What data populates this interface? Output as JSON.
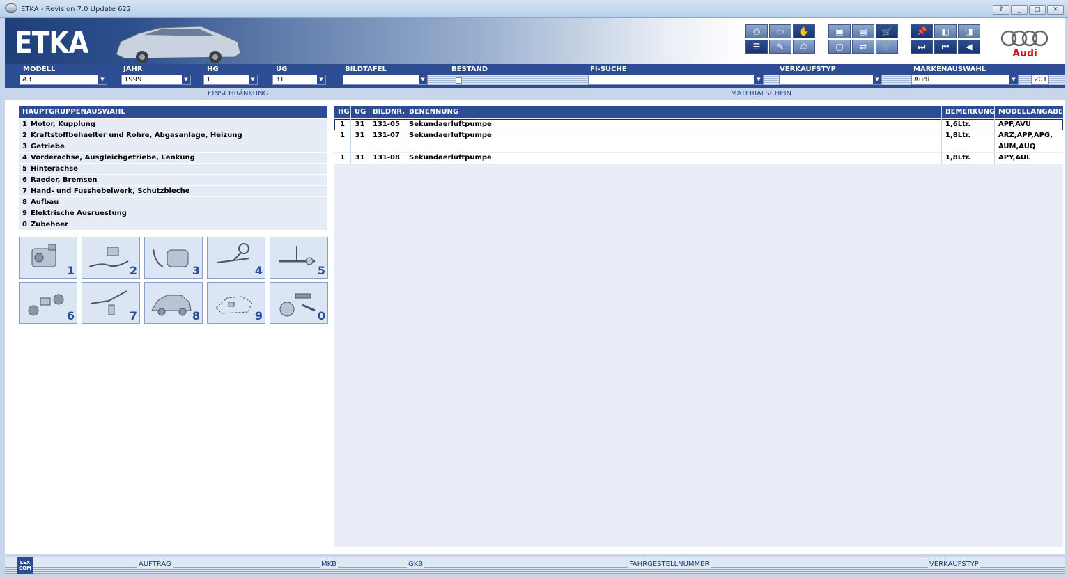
{
  "window": {
    "title": "ETKA - Revision 7.0 Update 622",
    "buttons": [
      "?",
      "_",
      "□",
      "✕"
    ]
  },
  "header": {
    "logo": "ETKA",
    "brand": "Audi"
  },
  "filters": {
    "modell": {
      "label": "MODELL",
      "value": "A3"
    },
    "jahr": {
      "label": "JAHR",
      "value": "1999"
    },
    "hg": {
      "label": "HG",
      "value": "1"
    },
    "ug": {
      "label": "UG",
      "value": "31"
    },
    "bildtafel": {
      "label": "BILDTAFEL",
      "value": ""
    },
    "bestand": {
      "label": "BESTAND"
    },
    "fi_suche": {
      "label": "FI-SUCHE",
      "value": ""
    },
    "verkaufstyp": {
      "label": "VERKAUFSTYP",
      "value": ""
    },
    "markenauswahl": {
      "label": "MARKENAUSWAHL",
      "value": "Audi",
      "extra": "201"
    }
  },
  "sections": {
    "left": "EINSCHRÄNKUNG",
    "right": "MATERIALSCHEIN"
  },
  "hauptgruppen": {
    "header": "HAUPTGRUPPENAUSWAHL",
    "items": [
      {
        "num": "1",
        "label": "Motor, Kupplung"
      },
      {
        "num": "2",
        "label": "Kraftstoffbehaelter und Rohre, Abgasanlage, Heizung"
      },
      {
        "num": "3",
        "label": "Getriebe"
      },
      {
        "num": "4",
        "label": "Vorderachse, Ausgleichgetriebe, Lenkung"
      },
      {
        "num": "5",
        "label": "Hinterachse"
      },
      {
        "num": "6",
        "label": "Raeder, Bremsen"
      },
      {
        "num": "7",
        "label": "Hand- und Fusshebelwerk, Schutzbleche"
      },
      {
        "num": "8",
        "label": "Aufbau"
      },
      {
        "num": "9",
        "label": "Elektrische Ausruestung"
      },
      {
        "num": "0",
        "label": "Zubehoer"
      }
    ],
    "thumbs": [
      "1",
      "2",
      "3",
      "4",
      "5",
      "6",
      "7",
      "8",
      "9",
      "0"
    ]
  },
  "table": {
    "columns": [
      "HG",
      "UG",
      "BILDNR.",
      "BENENNUNG",
      "BEMERKUNG",
      "MODELLANGABE"
    ],
    "rows": [
      {
        "hg": "1",
        "ug": "31",
        "bildnr": "131-05",
        "benennung": "Sekundaerluftpumpe",
        "bemerkung": "1,6Ltr.",
        "modell": "APF,AVU"
      },
      {
        "hg": "1",
        "ug": "31",
        "bildnr": "131-07",
        "benennung": "Sekundaerluftpumpe",
        "bemerkung": "1,8Ltr.",
        "modell": "ARZ,APP,APG, AUM,AUQ"
      },
      {
        "hg": "1",
        "ug": "31",
        "bildnr": "131-08",
        "benennung": "Sekundaerluftpumpe",
        "bemerkung": "1,8Ltr.",
        "modell": "APY,AUL"
      }
    ]
  },
  "bottom": {
    "lexcom": "LEX COM",
    "auftrag": "AUFTRAG",
    "mkb": "MKB",
    "gkb": "GKB",
    "fahrgestellnummer": "FAHRGESTELLNUMMER",
    "verkaufstyp": "VERKAUFSTYP"
  },
  "icons": [
    "print-icon",
    "book-icon",
    "handshake-icon",
    "list-icon",
    "pencil-icon",
    "scale-icon",
    "elsa-icon",
    "depot-icon",
    "cart-icon",
    "pin-icon",
    "page-back-icon",
    "page-forward-icon",
    "nav-first-icon",
    "nav-prev-icon",
    "nav-back-icon"
  ]
}
